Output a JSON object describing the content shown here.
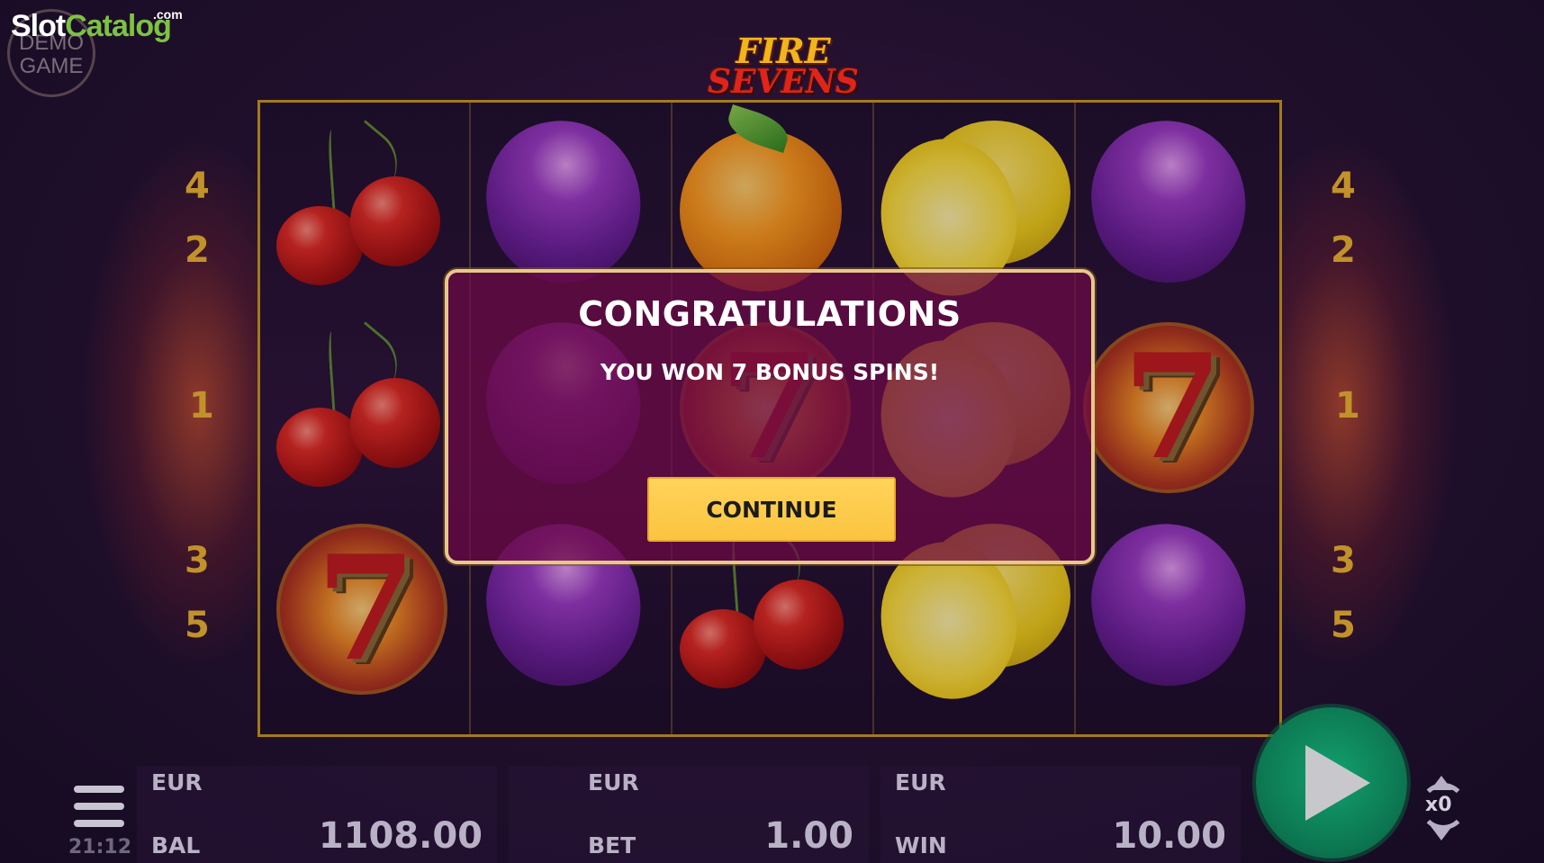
{
  "watermark": {
    "slot": "Slot",
    "catalog": "Catalog",
    "dotcom": ".com",
    "badge_line1": "DEMO",
    "badge_line2": "GAME"
  },
  "logo": {
    "line1": "FIRE",
    "line2": "SEVENS"
  },
  "paylines": {
    "left": [
      "4",
      "2",
      "1",
      "3",
      "5"
    ],
    "right": [
      "4",
      "2",
      "1",
      "3",
      "5"
    ]
  },
  "reels": [
    [
      "cherry",
      "cherry",
      "seven"
    ],
    [
      "plum",
      "plum",
      "plum"
    ],
    [
      "orange",
      "seven",
      "cherry"
    ],
    [
      "lemon",
      "lemon",
      "lemon"
    ],
    [
      "plum",
      "seven",
      "plum"
    ]
  ],
  "dialog": {
    "title": "CONGRATULATIONS",
    "message": "YOU WON 7 BONUS SPINS!",
    "continue_label": "CONTINUE"
  },
  "bottom_bar": {
    "balance": {
      "currency": "EUR",
      "label": "BAL",
      "value": "1108.00"
    },
    "bet": {
      "currency": "EUR",
      "label": "BET",
      "value": "1.00"
    },
    "win": {
      "currency": "EUR",
      "label": "WIN",
      "value": "10.00"
    },
    "clock": "21:12",
    "autoplay_count": "x0"
  },
  "colors": {
    "frame": "#c99a1b",
    "continue_button": "#fbc440",
    "spin_button": "#0d7a54",
    "payline_numbers": "#c2922a"
  }
}
